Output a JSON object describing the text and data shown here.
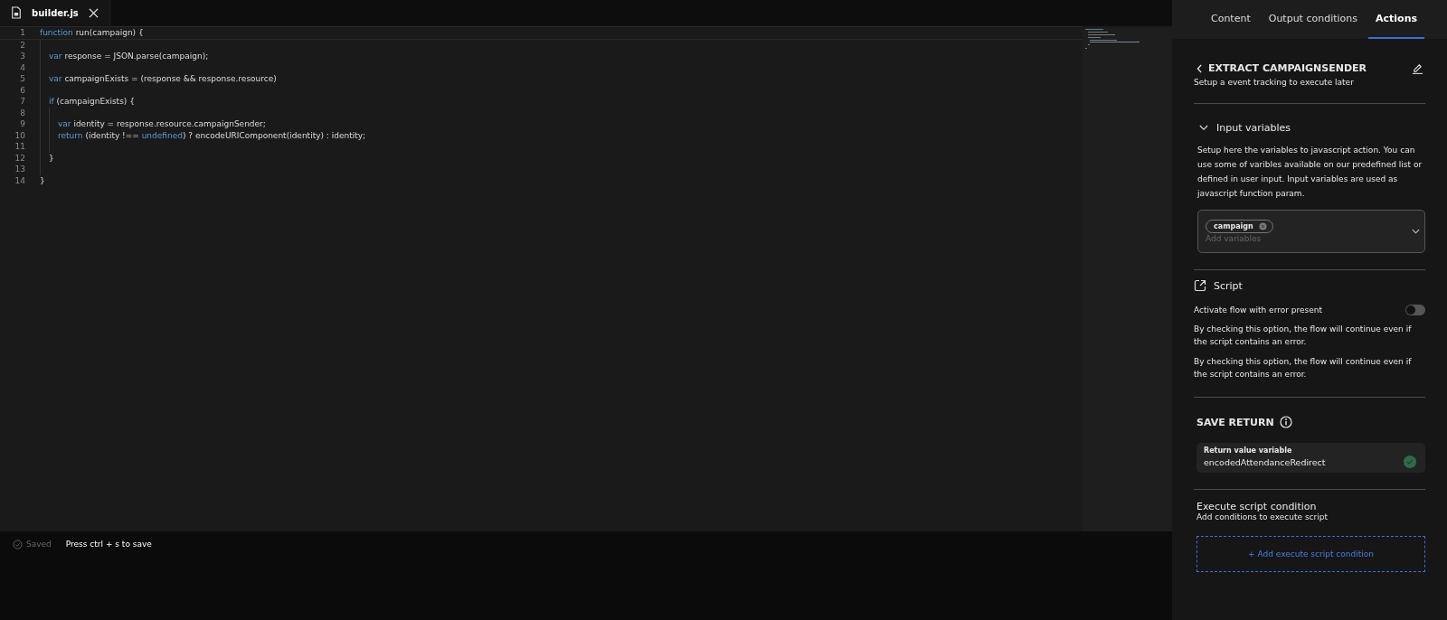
{
  "file_tab": {
    "label": "builder.js",
    "selected": true
  },
  "code": [
    {
      "number": "1",
      "tokens": [
        {
          "kind": "keyword",
          "text": "function"
        },
        {
          "kind": "plain",
          "text": " run(campaign) {"
        }
      ],
      "children": [
        {
          "number": "2"
        },
        {
          "number": "3",
          "tokens": [
            {
              "kind": "keyword",
              "text": "var"
            },
            {
              "kind": "plain",
              "text": " response = JSON.parse(campaign);"
            }
          ]
        },
        {
          "number": "4"
        },
        {
          "number": "5",
          "tokens": [
            {
              "kind": "keyword",
              "text": "var"
            },
            {
              "kind": "plain",
              "text": " campaignExists = (response && response.resource)"
            }
          ]
        },
        {
          "number": "6"
        },
        {
          "number": "7",
          "tokens": [
            {
              "kind": "keyword",
              "text": "if"
            },
            {
              "kind": "plain",
              "text": " (campaignExists) {"
            }
          ],
          "children": [
            {
              "number": "8"
            },
            {
              "number": "9",
              "tokens": [
                {
                  "kind": "keyword",
                  "text": "var"
                },
                {
                  "kind": "plain",
                  "text": " identity = response.resource.campaignSender;"
                }
              ]
            },
            {
              "number": "10",
              "tokens": [
                {
                  "kind": "keyword",
                  "text": "return"
                },
                {
                  "kind": "plain",
                  "text": " (identity !== "
                },
                {
                  "kind": "keyword",
                  "text": "undefined"
                },
                {
                  "kind": "plain",
                  "text": ") ? encodeURIComponent(identity) : identity;"
                }
              ]
            },
            {
              "number": "11"
            }
          ]
        },
        {
          "number": "12",
          "tokens": [
            {
              "kind": "plain",
              "text": "}"
            }
          ]
        },
        {
          "number": "13"
        }
      ]
    },
    {
      "number": "14",
      "tokens": [
        {
          "kind": "plain",
          "text": "}"
        }
      ]
    }
  ],
  "status_bar": {
    "saved": "Saved",
    "hint": "Press ctrl + s to save"
  },
  "panel_tabs": [
    {
      "label": "Content",
      "selected": false
    },
    {
      "label": "Output conditions",
      "selected": false
    },
    {
      "label": "Actions",
      "selected": true
    }
  ],
  "action": {
    "title": "EXTRACT CAMPAIGNSENDER",
    "subtitle": "Setup a event tracking to execute later"
  },
  "input_variables": {
    "title": "Input variables",
    "expanded": true,
    "description": "Setup here the variables to javascript action. You can use some of varibles available on our predefined list or defined in user input. Input variables are used as javascript function param.",
    "chips": [
      "campaign"
    ],
    "placeholder": "Add variables"
  },
  "script": {
    "title": "Script",
    "toggle_label": "Activate flow with error present",
    "on": false,
    "notes": [
      "By checking this option, the flow will continue even if the script contains an error.",
      "By checking this option, the flow will continue even if the script contains an error."
    ]
  },
  "save_return": {
    "title": "SAVE RETURN",
    "field_label": "Return value variable",
    "value": "encodedAttendanceRedirect",
    "valid": true
  },
  "condition": {
    "title": "Execute script condition",
    "subtitle": "Add conditions to execute script",
    "button": "+ Add execute script condition"
  }
}
